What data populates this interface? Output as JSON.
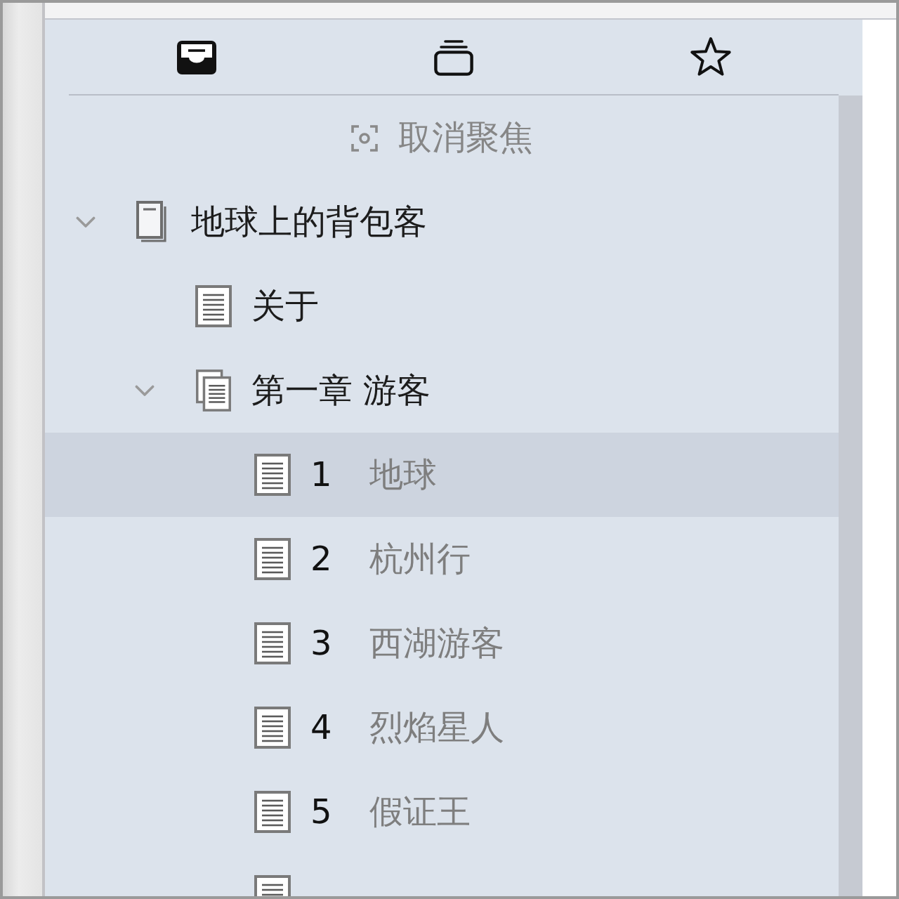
{
  "toolbar": {
    "tabs": [
      {
        "kind": "tray",
        "selected": true
      },
      {
        "kind": "stack",
        "selected": false
      },
      {
        "kind": "star",
        "selected": false
      }
    ]
  },
  "focus_button": {
    "label": "取消聚焦"
  },
  "binder": {
    "items": [
      {
        "kind": "book",
        "title": "地球上的背包客",
        "expanded": true,
        "selected": false,
        "children": [
          {
            "kind": "document",
            "title": "关于",
            "selected": false
          },
          {
            "kind": "group",
            "title": "第一章 游客",
            "expanded": true,
            "selected": false,
            "children": [
              {
                "kind": "document",
                "number": "1",
                "title": "地球",
                "selected": true
              },
              {
                "kind": "document",
                "number": "2",
                "title": "杭州行",
                "selected": false
              },
              {
                "kind": "document",
                "number": "3",
                "title": "西湖游客",
                "selected": false
              },
              {
                "kind": "document",
                "number": "4",
                "title": "烈焰星人",
                "selected": false
              },
              {
                "kind": "document",
                "number": "5",
                "title": "假证王",
                "selected": false
              },
              {
                "kind": "document",
                "selected": false
              }
            ]
          }
        ]
      }
    ]
  }
}
